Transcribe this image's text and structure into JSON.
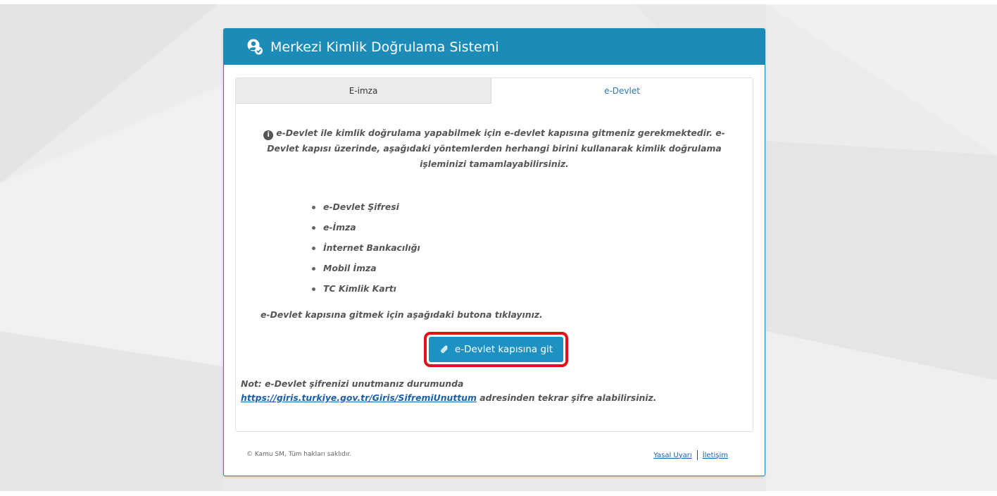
{
  "header": {
    "title": "Merkezi Kimlik Doğrulama Sistemi",
    "logo_icon": "user-check-icon"
  },
  "tabs": [
    {
      "label": "E-imza",
      "active": false
    },
    {
      "label": "e-Devlet",
      "active": true
    }
  ],
  "content": {
    "intro": "e-Devlet ile kimlik doğrulama yapabilmek için e-devlet kapısına gitmeniz gerekmektedir. e-Devlet kapısı üzerinde, aşağıdaki yöntemlerden herhangi birini kullanarak kimlik doğrulama işleminizi tamamlayabilirsiniz.",
    "methods": [
      "e-Devlet Şifresi",
      "e-İmza",
      "İnternet Bankacılığı",
      "Mobil İmza",
      "TC Kimlik Kartı"
    ],
    "goto_text": "e-Devlet kapısına gitmek için aşağıdaki butona tıklayınız.",
    "button_label": "e-Devlet kapısına git",
    "note_prefix": "Not: e-Devlet şifrenizi unutmanız durumunda",
    "note_link": "https://giris.turkiye.gov.tr/Giris/SifremiUnuttum",
    "note_suffix": " adresinden tekrar şifre alabilirsiniz."
  },
  "footer": {
    "copyright": "© Kamu SM, Tüm hakları saklıdır.",
    "legal_link": "Yasal Uyarı",
    "contact_link": "İletişim"
  },
  "colors": {
    "header_bg": "#1d8bb8",
    "button_bg": "#1c91c2",
    "highlight_border": "#e2121c",
    "link": "#1a5fa8"
  }
}
